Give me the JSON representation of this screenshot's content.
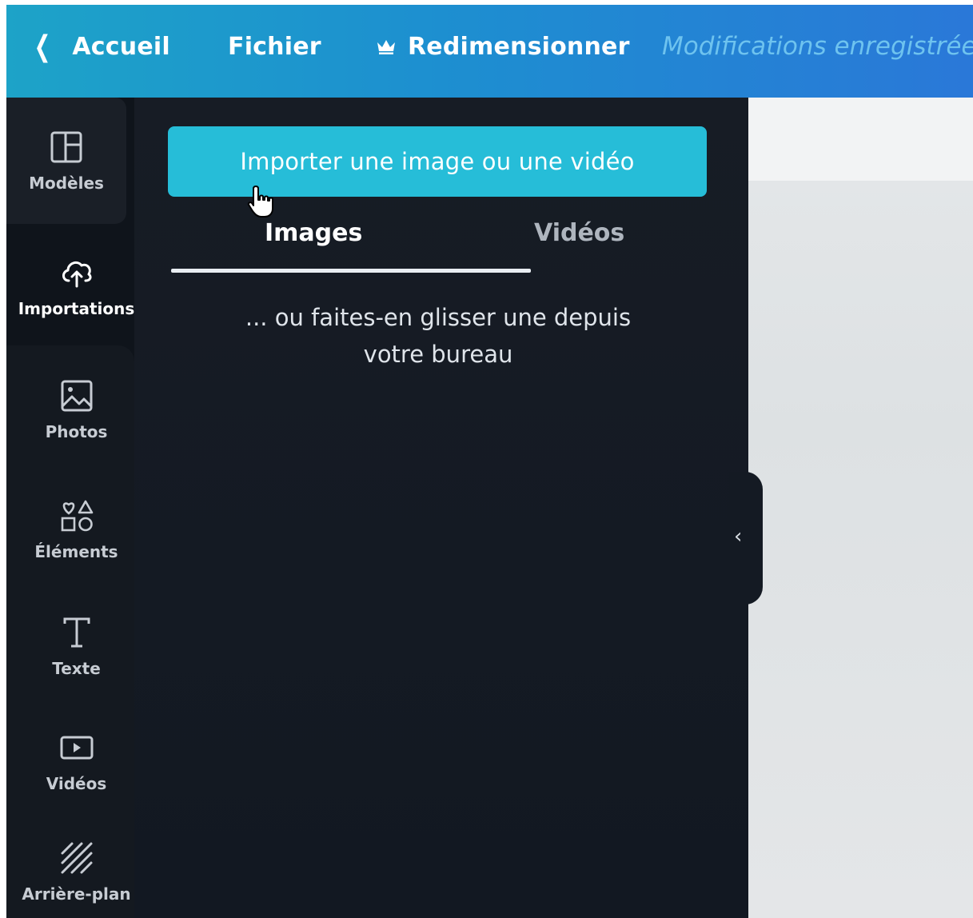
{
  "topbar": {
    "back_label": "Accueil",
    "file_label": "Fichier",
    "resize_label": "Redimensionner",
    "status": "Modifications enregistrées"
  },
  "sidebar": {
    "items": [
      {
        "label": "Modèles",
        "icon": "templates-icon"
      },
      {
        "label": "Importations",
        "icon": "cloud-upload-icon"
      },
      {
        "label": "Photos",
        "icon": "image-icon"
      },
      {
        "label": "Éléments",
        "icon": "shapes-icon"
      },
      {
        "label": "Texte",
        "icon": "text-icon"
      },
      {
        "label": "Vidéos",
        "icon": "video-icon"
      },
      {
        "label": "Arrière-plan",
        "icon": "background-icon"
      }
    ]
  },
  "panel": {
    "upload_button": "Importer une image ou une vidéo",
    "tabs": [
      {
        "label": "Images",
        "active": true
      },
      {
        "label": "Vidéos",
        "active": false
      }
    ],
    "drop_hint_line1": "... ou faites-en glisser une depuis",
    "drop_hint_line2": "votre bureau"
  },
  "colors": {
    "accent": "#26bdd8",
    "topbar": "#1d8fd0",
    "panel_bg": "#151b24",
    "status_text": "#6ec3ef"
  }
}
